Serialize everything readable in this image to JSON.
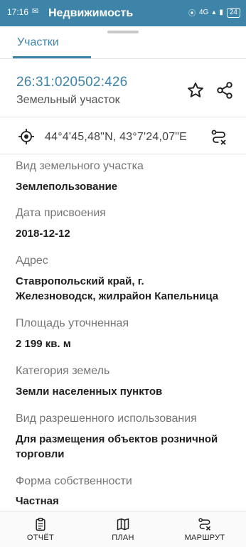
{
  "status_bar": {
    "time": "17:16",
    "battery": "24",
    "network": "4G"
  },
  "app": {
    "title": "Недвижимость"
  },
  "tabs": [
    {
      "label": "Участки",
      "active": true
    }
  ],
  "parcel": {
    "cadastral_number": "26:31:020502:426",
    "type": "Земельный участок",
    "coordinates": "44°4'45,48\"N, 43°7'24,07\"E"
  },
  "fields": [
    {
      "label": "Вид земельного участка",
      "value": "Землепользование"
    },
    {
      "label": "Дата присвоения",
      "value": "2018-12-12"
    },
    {
      "label": "Адрес",
      "value_lines": [
        "Ставропольский край, г.",
        "Железноводск, жилрайон Капельница"
      ]
    },
    {
      "label": "Площадь уточненная",
      "value": "2 199 кв. м"
    },
    {
      "label": "Категория земель",
      "value": "Земли населенных пунктов"
    },
    {
      "label": "Вид разрешенного использования",
      "value_lines": [
        "Для размещения объектов розничной",
        "торговли"
      ]
    },
    {
      "label": "Форма собственности",
      "value": "Частная"
    }
  ],
  "bottom_nav": [
    {
      "label": "ОТЧЁТ",
      "icon": "report-icon"
    },
    {
      "label": "ПЛАН",
      "icon": "map-icon"
    },
    {
      "label": "МАРШРУТ",
      "icon": "route-icon"
    }
  ],
  "colors": {
    "accent": "#3e84a8",
    "label": "#757575",
    "value": "#1e1e1e"
  }
}
